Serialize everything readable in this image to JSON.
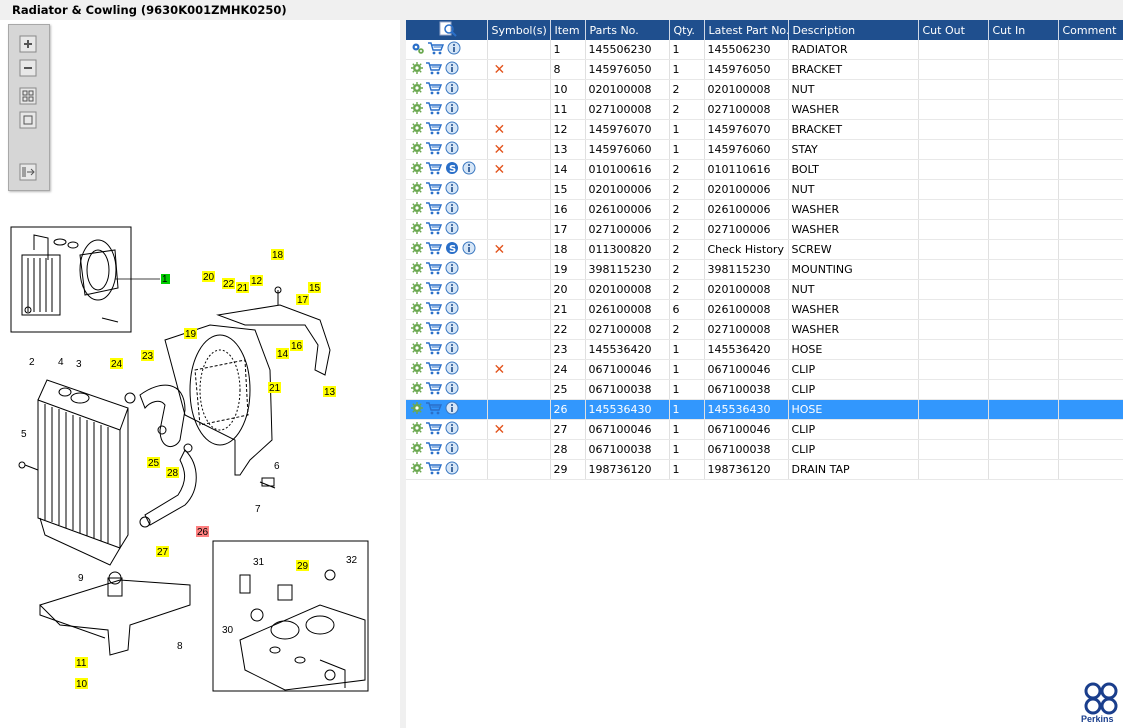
{
  "window": {
    "title": "Radiator & Cowling (9630K001ZMHK0250)"
  },
  "toolbar": {
    "buttons": [
      "zoom-in-icon",
      "zoom-out-icon",
      "fit-all-icon",
      "fit-page-icon",
      "export-icon"
    ]
  },
  "diagram": {
    "callouts_highlighted": [
      "1",
      "18",
      "20",
      "22",
      "21",
      "12",
      "15",
      "17",
      "16",
      "14",
      "19",
      "24",
      "23",
      "13",
      "21",
      "25",
      "28",
      "26",
      "27",
      "11",
      "10",
      "29"
    ],
    "callouts_plain": [
      "2",
      "4",
      "3",
      "5",
      "6",
      "7",
      "9",
      "8",
      "31",
      "32",
      "30"
    ]
  },
  "table": {
    "columns": [
      "",
      "Symbol(s)",
      "Item",
      "Parts No.",
      "Qty.",
      "Latest Part No.",
      "Description",
      "Cut Out",
      "Cut In",
      "Comment"
    ],
    "rows": [
      {
        "icons": [
          "config-icon",
          "cart-icon",
          "info-icon"
        ],
        "symbol": "",
        "item": "1",
        "part": "145506230",
        "qty": "1",
        "latest": "145506230",
        "desc": "RADIATOR"
      },
      {
        "icons": [
          "gear-icon",
          "cart-icon",
          "info-icon"
        ],
        "symbol": "x",
        "item": "8",
        "part": "145976050",
        "qty": "1",
        "latest": "145976050",
        "desc": "BRACKET"
      },
      {
        "icons": [
          "gear-icon",
          "cart-icon",
          "info-icon"
        ],
        "symbol": "",
        "item": "10",
        "part": "020100008",
        "qty": "2",
        "latest": "020100008",
        "desc": "NUT"
      },
      {
        "icons": [
          "gear-icon",
          "cart-icon",
          "info-icon"
        ],
        "symbol": "",
        "item": "11",
        "part": "027100008",
        "qty": "2",
        "latest": "027100008",
        "desc": "WASHER"
      },
      {
        "icons": [
          "gear-icon",
          "cart-icon",
          "info-icon"
        ],
        "symbol": "x",
        "item": "12",
        "part": "145976070",
        "qty": "1",
        "latest": "145976070",
        "desc": "BRACKET"
      },
      {
        "icons": [
          "gear-icon",
          "cart-icon",
          "info-icon"
        ],
        "symbol": "x",
        "item": "13",
        "part": "145976060",
        "qty": "1",
        "latest": "145976060",
        "desc": "STAY"
      },
      {
        "icons": [
          "gear-icon",
          "cart-icon",
          "superseded-icon",
          "info-icon"
        ],
        "symbol": "x",
        "item": "14",
        "part": "010100616",
        "qty": "2",
        "latest": "010110616",
        "desc": "BOLT"
      },
      {
        "icons": [
          "gear-icon",
          "cart-icon",
          "info-icon"
        ],
        "symbol": "",
        "item": "15",
        "part": "020100006",
        "qty": "2",
        "latest": "020100006",
        "desc": "NUT"
      },
      {
        "icons": [
          "gear-icon",
          "cart-icon",
          "info-icon"
        ],
        "symbol": "",
        "item": "16",
        "part": "026100006",
        "qty": "2",
        "latest": "026100006",
        "desc": "WASHER"
      },
      {
        "icons": [
          "gear-icon",
          "cart-icon",
          "info-icon"
        ],
        "symbol": "",
        "item": "17",
        "part": "027100006",
        "qty": "2",
        "latest": "027100006",
        "desc": "WASHER"
      },
      {
        "icons": [
          "gear-icon",
          "cart-icon",
          "superseded-icon",
          "info-icon"
        ],
        "symbol": "x",
        "item": "18",
        "part": "011300820",
        "qty": "2",
        "latest": "Check History",
        "desc": "SCREW"
      },
      {
        "icons": [
          "gear-icon",
          "cart-icon",
          "info-icon"
        ],
        "symbol": "",
        "item": "19",
        "part": "398115230",
        "qty": "2",
        "latest": "398115230",
        "desc": "MOUNTING"
      },
      {
        "icons": [
          "gear-icon",
          "cart-icon",
          "info-icon"
        ],
        "symbol": "",
        "item": "20",
        "part": "020100008",
        "qty": "2",
        "latest": "020100008",
        "desc": "NUT"
      },
      {
        "icons": [
          "gear-icon",
          "cart-icon",
          "info-icon"
        ],
        "symbol": "",
        "item": "21",
        "part": "026100008",
        "qty": "6",
        "latest": "026100008",
        "desc": "WASHER"
      },
      {
        "icons": [
          "gear-icon",
          "cart-icon",
          "info-icon"
        ],
        "symbol": "",
        "item": "22",
        "part": "027100008",
        "qty": "2",
        "latest": "027100008",
        "desc": "WASHER"
      },
      {
        "icons": [
          "gear-icon",
          "cart-icon",
          "info-icon"
        ],
        "symbol": "",
        "item": "23",
        "part": "145536420",
        "qty": "1",
        "latest": "145536420",
        "desc": "HOSE"
      },
      {
        "icons": [
          "gear-icon",
          "cart-icon",
          "info-icon"
        ],
        "symbol": "x",
        "item": "24",
        "part": "067100046",
        "qty": "1",
        "latest": "067100046",
        "desc": "CLIP"
      },
      {
        "icons": [
          "gear-icon",
          "cart-icon",
          "info-icon"
        ],
        "symbol": "",
        "item": "25",
        "part": "067100038",
        "qty": "1",
        "latest": "067100038",
        "desc": "CLIP"
      },
      {
        "icons": [
          "gear-icon",
          "cart-icon",
          "info-icon"
        ],
        "symbol": "",
        "item": "26",
        "part": "145536430",
        "qty": "1",
        "latest": "145536430",
        "desc": "HOSE",
        "selected": true
      },
      {
        "icons": [
          "gear-icon",
          "cart-icon",
          "info-icon"
        ],
        "symbol": "x",
        "item": "27",
        "part": "067100046",
        "qty": "1",
        "latest": "067100046",
        "desc": "CLIP"
      },
      {
        "icons": [
          "gear-icon",
          "cart-icon",
          "info-icon"
        ],
        "symbol": "",
        "item": "28",
        "part": "067100038",
        "qty": "1",
        "latest": "067100038",
        "desc": "CLIP"
      },
      {
        "icons": [
          "gear-icon",
          "cart-icon",
          "info-icon"
        ],
        "symbol": "",
        "item": "29",
        "part": "198736120",
        "qty": "1",
        "latest": "198736120",
        "desc": "DRAIN TAP"
      }
    ]
  },
  "brand": {
    "name": "Perkins",
    "color": "#1a3e8c"
  },
  "colors": {
    "header": "#1f4f8e",
    "selected": "#3297fd",
    "highlight": "#ffff00",
    "highlight_green": "#00cc00",
    "highlight_red": "#ff8080",
    "symbol_x": "#e2531c"
  }
}
